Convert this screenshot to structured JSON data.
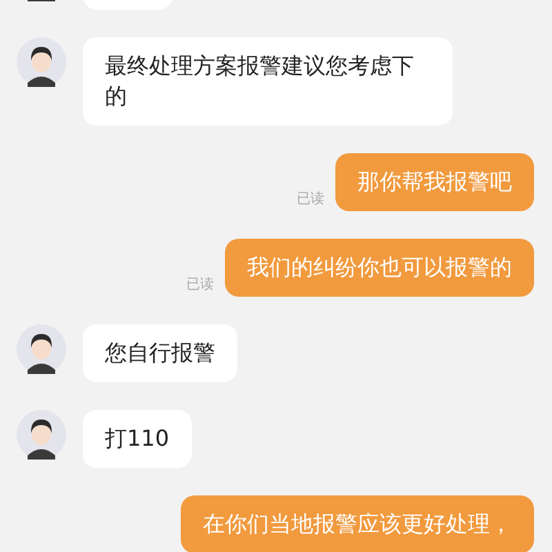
{
  "messages": [
    {
      "kind": "incoming"
    },
    {
      "kind": "incoming",
      "text": "最终处理方案报警建议您考虑下的"
    },
    {
      "kind": "outgoing",
      "text": "那你帮我报警吧",
      "status": "已读"
    },
    {
      "kind": "outgoing",
      "text": "我们的纠纷你也可以报警的",
      "status": "已读"
    },
    {
      "kind": "incoming",
      "text": "您自行报警"
    },
    {
      "kind": "incoming",
      "text": "打110"
    },
    {
      "kind": "outgoing",
      "text": "在你们当地报警应该更好处理，"
    }
  ]
}
